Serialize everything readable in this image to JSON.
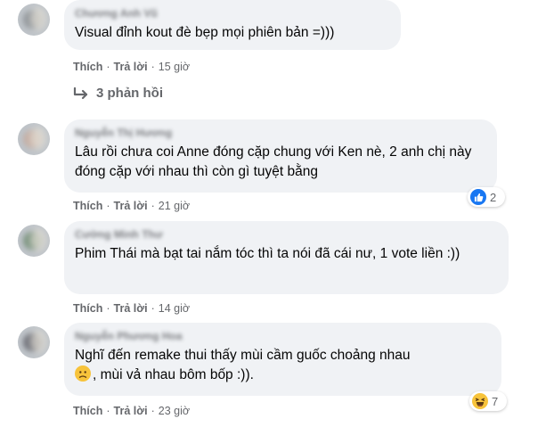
{
  "comments": [
    {
      "author": "Chương Anh Vũ",
      "text": "Visual đỉnh kout đè bẹp mọi phiên bản =)))",
      "like_label": "Thích",
      "reply_label": "Trả lời",
      "time": "15 giờ"
    },
    {
      "author": "Nguyễn Thị Hương",
      "text": "Lâu rồi chưa coi Anne đóng cặp chung với Ken nè, 2 anh chị này đóng cặp với nhau thì còn gì tuyệt bằng",
      "like_label": "Thích",
      "reply_label": "Trả lời",
      "time": "21 giờ",
      "reaction_count": "2",
      "reaction_type": "like-icon"
    },
    {
      "author": "Cường Minh Thư",
      "text": "Phim Thái mà bạt tai nắm tóc thì ta nói đã cái nư, 1 vote liền :))",
      "like_label": "Thích",
      "reply_label": "Trả lời",
      "time": "14 giờ"
    },
    {
      "author": "Nguyễn Phương Hoa",
      "text_part1": "Nghĩ đến remake thui thấy mùi cầm guốc choảng nhau",
      "text_part2": ", mùi vả nhau bôm bốp :)).",
      "like_label": "Thích",
      "reply_label": "Trả lời",
      "time": "23 giờ",
      "reaction_count": "7",
      "reaction_type": "haha-icon"
    }
  ],
  "replies_link": "3 phản hồi",
  "colors": {
    "bubble": "#f0f2f5",
    "meta_text": "#65676b",
    "like_blue": "#1877f2",
    "emoji_yellow": "#f7c33b"
  }
}
